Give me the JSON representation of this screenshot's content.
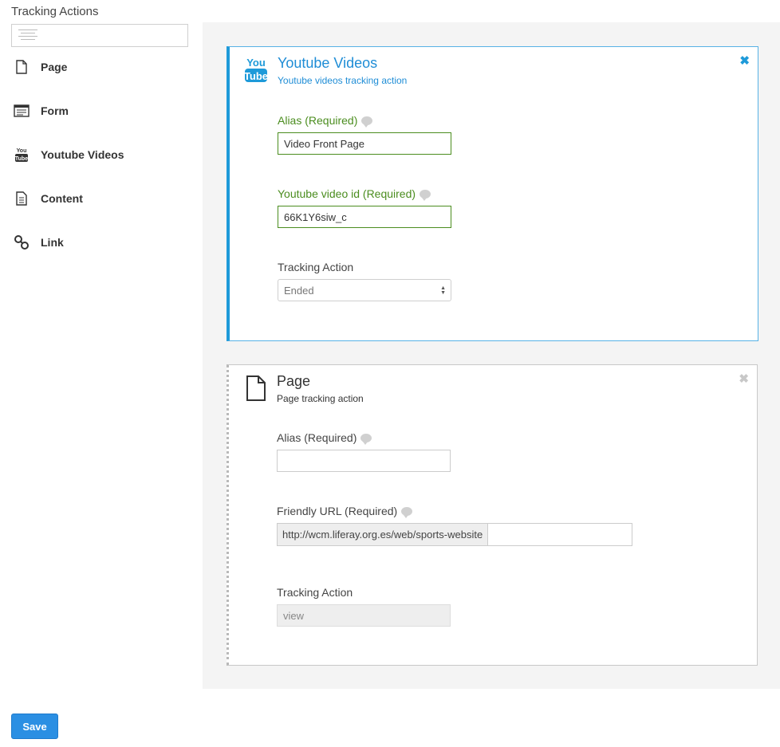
{
  "sidebar": {
    "title": "Tracking Actions",
    "items": [
      {
        "label": "Page",
        "icon": "page-icon"
      },
      {
        "label": "Form",
        "icon": "form-icon"
      },
      {
        "label": "Youtube Videos",
        "icon": "youtube-icon"
      },
      {
        "label": "Content",
        "icon": "content-icon"
      },
      {
        "label": "Link",
        "icon": "link-icon"
      }
    ]
  },
  "cards": {
    "youtube": {
      "icon_text_top": "You",
      "icon_text_bottom": "Tube",
      "title": "Youtube Videos",
      "subtitle": "Youtube videos tracking action",
      "close": "✖",
      "alias_label": "Alias (Required)",
      "alias_value": "Video Front Page",
      "video_label": "Youtube video id (Required)",
      "video_value": "66K1Y6siw_c",
      "action_label": "Tracking Action",
      "action_value": "Ended"
    },
    "page": {
      "title": "Page",
      "subtitle": "Page tracking action",
      "close": "✖",
      "alias_label": "Alias (Required)",
      "alias_value": "",
      "url_label": "Friendly URL (Required)",
      "url_prefix": "http://wcm.liferay.org.es/web/sports-website",
      "url_value": "",
      "action_label": "Tracking Action",
      "action_value": "view"
    }
  },
  "footer": {
    "save_label": "Save"
  },
  "colors": {
    "accent": "#1e9ad9",
    "valid": "#4b8d1f",
    "button": "#2b8fe3"
  }
}
